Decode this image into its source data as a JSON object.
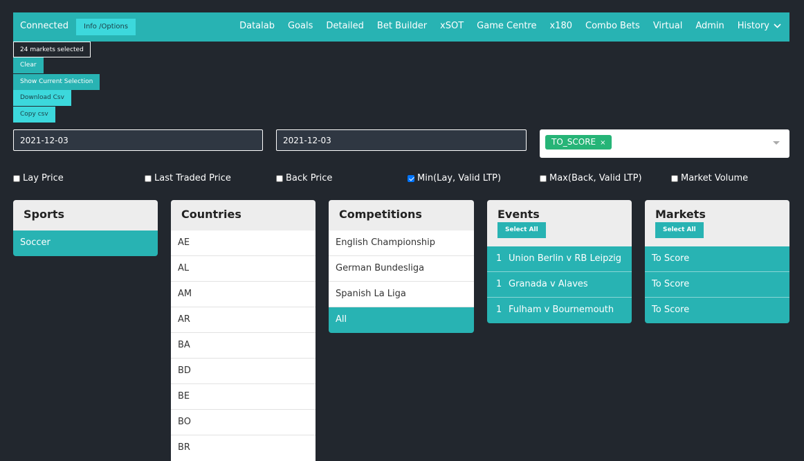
{
  "navbar": {
    "status": "Connected",
    "info_button": "Info /Options",
    "links": [
      "Datalab",
      "Goals",
      "Detailed",
      "Bet Builder",
      "xSOT",
      "Game Centre",
      "x180",
      "Combo Bets",
      "Virtual",
      "Admin"
    ],
    "history_label": "History"
  },
  "actions": {
    "markets_selected": "24 markets selected",
    "clear": "Clear",
    "show_selection": "Show Current Selection",
    "download_csv": "Download Csv",
    "copy_csv": "Copy csv"
  },
  "filters": {
    "date_from": "2021-12-03",
    "date_to": "2021-12-03",
    "market_type_chip": "TO_SCORE",
    "chip_remove": "×"
  },
  "price_options": [
    {
      "label": "Lay Price",
      "checked": false
    },
    {
      "label": "Last Traded Price",
      "checked": false
    },
    {
      "label": "Back Price",
      "checked": false
    },
    {
      "label": "Min(Lay, Valid LTP)",
      "checked": true
    },
    {
      "label": "Max(Back, Valid LTP)",
      "checked": false
    },
    {
      "label": "Market Volume",
      "checked": false
    }
  ],
  "panels": {
    "sports": {
      "title": "Sports",
      "items": [
        "Soccer"
      ]
    },
    "countries": {
      "title": "Countries",
      "items": [
        "AE",
        "AL",
        "AM",
        "AR",
        "BA",
        "BD",
        "BE",
        "BO",
        "BR"
      ]
    },
    "competitions": {
      "title": "Competitions",
      "items": [
        "English Championship",
        "German Bundesliga",
        "Spanish La Liga",
        "All"
      ]
    },
    "events": {
      "title": "Events",
      "select_all": "Select All",
      "items": [
        {
          "count": "1",
          "name": "Union Berlin v RB Leipzig"
        },
        {
          "count": "1",
          "name": "Granada v Alaves"
        },
        {
          "count": "1",
          "name": "Fulham v Bournemouth"
        }
      ]
    },
    "markets": {
      "title": "Markets",
      "select_all": "Select All",
      "items": [
        "To Score",
        "To Score",
        "To Score"
      ]
    }
  },
  "colors": {
    "accent": "#28b3b3",
    "background": "#22272e",
    "chip": "#26b477",
    "checkbox": "#0075ff"
  }
}
